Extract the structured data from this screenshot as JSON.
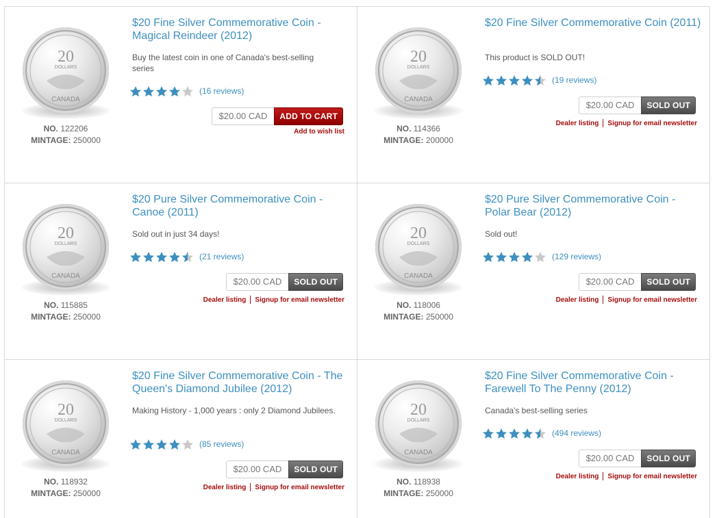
{
  "colors": {
    "accent": "#3d8fbf",
    "star_on": "#3d8fbf",
    "star_off": "#c8c8c8",
    "cart": "#b01010",
    "sold": "#5a5a5a",
    "link_red": "#a40d0d"
  },
  "labels": {
    "no": "NO.",
    "mintage": "MINTAGE:",
    "add_to_wish": "Add to wish list",
    "dealer": "Dealer listing",
    "signup": "Signup for email newsletter"
  },
  "products": [
    {
      "title": "$20 Fine Silver Commemorative Coin - Magical Reindeer (2012)",
      "desc": "Buy the latest coin in one of Canada's best-selling series",
      "rating": 4,
      "reviews": "(16 reviews)",
      "price": "$20.00 CAD",
      "button": "ADD TO CART",
      "status": "cart",
      "no": "122206",
      "mintage": "250000",
      "coin_icon": "reindeer-coin-icon"
    },
    {
      "title": "$20 Fine Silver Commemorative Coin (2011)",
      "desc": "This product is SOLD OUT!",
      "rating": 4.5,
      "reviews": "(19 reviews)",
      "price": "$20.00 CAD",
      "button": "SOLD OUT",
      "status": "sold",
      "no": "114366",
      "mintage": "200000",
      "coin_icon": "maple-leaf-coin-icon"
    },
    {
      "title": "$20 Pure Silver Commemorative Coin - Canoe (2011)",
      "desc": "Sold out in just 34 days!",
      "rating": 4.5,
      "reviews": "(21 reviews)",
      "price": "$20.00 CAD",
      "button": "SOLD OUT",
      "status": "sold",
      "no": "115885",
      "mintage": "250000",
      "coin_icon": "canoe-coin-icon"
    },
    {
      "title": "$20 Pure Silver Commemorative Coin - Polar Bear (2012)",
      "desc": "Sold out!",
      "rating": 4,
      "reviews": "(129 reviews)",
      "price": "$20.00 CAD",
      "button": "SOLD OUT",
      "status": "sold",
      "no": "118006",
      "mintage": "250000",
      "coin_icon": "polar-bear-coin-icon"
    },
    {
      "title": "$20 Fine Silver Commemorative Coin - The Queen's Diamond Jubilee (2012)",
      "desc": "Making History - 1,000 years : only 2 Diamond Jubilees.",
      "rating": 4,
      "reviews": "(85 reviews)",
      "price": "$20.00 CAD",
      "button": "SOLD OUT",
      "status": "sold",
      "no": "118932",
      "mintage": "250000",
      "coin_icon": "queen-coin-icon"
    },
    {
      "title": "$20 Fine Silver Commemorative Coin - Farewell To The Penny (2012)",
      "desc": "Canada's best-selling series",
      "rating": 4.5,
      "reviews": "(494 reviews)",
      "price": "$20.00 CAD",
      "button": "SOLD OUT",
      "status": "sold",
      "no": "118938",
      "mintage": "250000",
      "coin_icon": "penny-leaves-coin-icon"
    }
  ]
}
